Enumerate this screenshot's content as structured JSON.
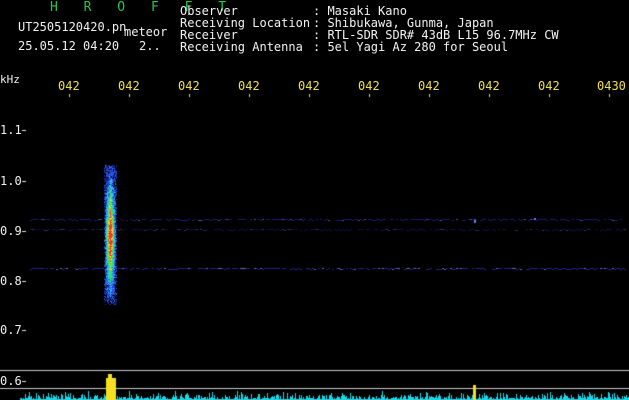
{
  "header": {
    "app_title": "H R O F F T",
    "file_name": "UT2505120420.pn",
    "file_tag": "meteor",
    "timestamp": "25.05.12 04:20",
    "page_indicator": "2..",
    "info_labels": [
      "Observer",
      "Receiving Location",
      "Receiver",
      "Receiving Antenna"
    ],
    "info_values": [
      ": Masaki Kano",
      ": Shibukawa, Gunma, Japan",
      ": RTL-SDR SDR# 43dB L15 96.7MHz CW",
      ": 5el Yagi Az 280 for Seoul"
    ]
  },
  "time_axis": {
    "ticks": [
      "042",
      "042",
      "042",
      "042",
      "042",
      "042",
      "042",
      "042",
      "042",
      "0430"
    ]
  },
  "freq_axis": {
    "unit": "kHz",
    "ticks": [
      "1.1",
      "1.0",
      "0.9",
      "0.8",
      "0.7",
      "0.6"
    ]
  },
  "colors": {
    "header_title": "#22c84a",
    "tick_labels": "#f2e24a",
    "lower_spectrum": "#18d8e8",
    "meteor_peak": "#f4e020",
    "carrier_line": "#2030c0"
  }
}
